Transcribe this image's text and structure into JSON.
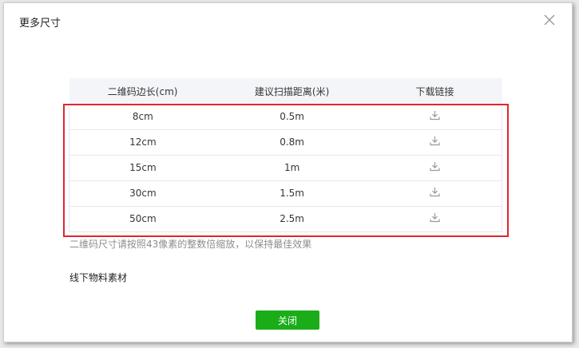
{
  "dialog": {
    "title": "更多尺寸",
    "close_icon": "close-x-icon"
  },
  "table": {
    "headers": [
      "二维码边长(cm)",
      "建议扫描距离(米)",
      "下载链接"
    ],
    "rows": [
      {
        "size": "8cm",
        "distance": "0.5m",
        "download_icon": "download-icon"
      },
      {
        "size": "12cm",
        "distance": "0.8m",
        "download_icon": "download-icon"
      },
      {
        "size": "15cm",
        "distance": "1m",
        "download_icon": "download-icon"
      },
      {
        "size": "30cm",
        "distance": "1.5m",
        "download_icon": "download-icon"
      },
      {
        "size": "50cm",
        "distance": "2.5m",
        "download_icon": "download-icon"
      }
    ]
  },
  "note": "二维码尺寸请按照43像素的整数倍缩放，以保持最佳效果",
  "section_title": "线下物料素材",
  "close_button_label": "关闭",
  "colors": {
    "primary_green": "#1aad19",
    "highlight_red": "#e0262e",
    "header_bg": "#f4f5f9"
  }
}
